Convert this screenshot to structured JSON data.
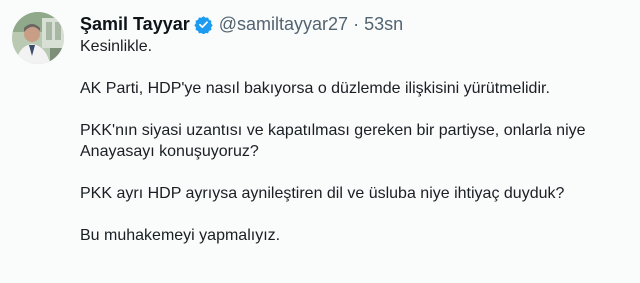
{
  "author": {
    "name": "Şamil Tayyar",
    "handle": "@samiltayyar27",
    "separator": "·",
    "time": "53sn",
    "verified_icon": "verified-badge-icon",
    "verified_color": "#1d9bf0"
  },
  "tweet": {
    "lines": [
      "Kesinlikle.",
      "AK Parti, HDP'ye nasıl bakıyorsa o düzlemde ilişkisini yürütmelidir.",
      "PKK'nın siyasi uzantısı ve kapatılması gereken bir partiyse, onlarla niye",
      "Anayasayı konuşuyoruz?",
      "PKK ayrı HDP ayrıysa aynileştiren dil ve üsluba niye ihtiyaç duyduk?",
      "Bu muhakemeyi yapmalıyız."
    ]
  }
}
